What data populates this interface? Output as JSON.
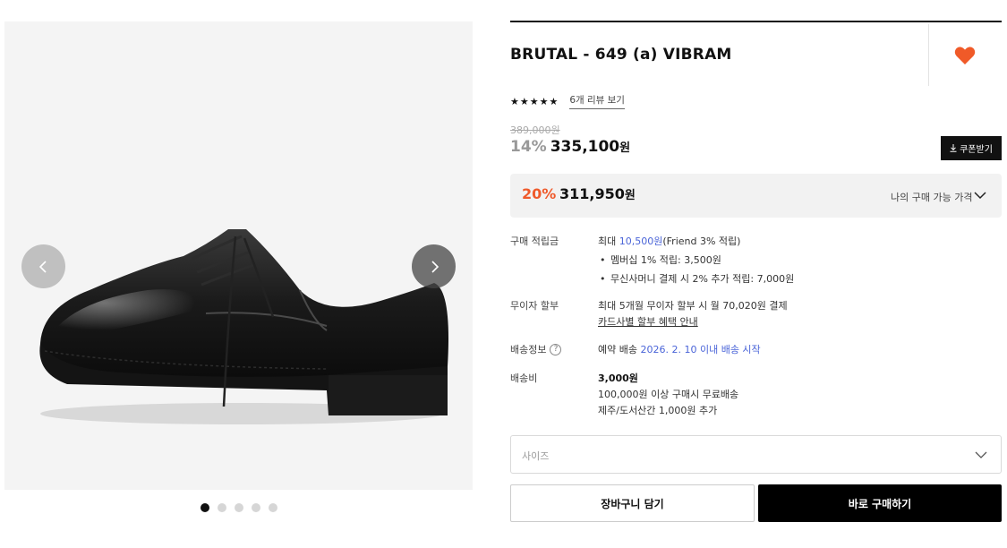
{
  "product": {
    "title": "BRUTAL - 649 (a) VIBRAM",
    "image_alt": "black leather derby shoe"
  },
  "gallery": {
    "prev_icon": "chevron-left-icon",
    "next_icon": "chevron-right-icon",
    "dot_count": 5,
    "active_dot": 1
  },
  "rating": {
    "stars": "★★★★★",
    "review_link": "6개 리뷰 보기"
  },
  "pricing": {
    "original": "389,000원",
    "sale_rate": "14%",
    "sale_price": "335,100",
    "sale_unit": "원",
    "coupon_label": "쿠폰받기",
    "my_rate": "20%",
    "my_price": "311,950",
    "my_unit": "원",
    "my_price_label": "나의 구매 가능 가격"
  },
  "points": {
    "label": "구매 적립금",
    "prefix": "최대",
    "amount": "10,500원",
    "suffix": "(Friend 3% 적립)",
    "bullet1": "멤버십 1% 적립: 3,500원",
    "bullet2": "무신사머니 결제 시 2% 추가 적립: 7,000원"
  },
  "installment": {
    "label": "무이자 할부",
    "text": "최대 5개월 무이자 할부 시 월 70,020원 결제",
    "link": "카드사별 할부 혜택 안내"
  },
  "delivery": {
    "label": "배송정보",
    "prefix": "예약 배송",
    "date_text": "2026. 2. 10 이내 배송 시작"
  },
  "shipping_fee": {
    "label": "배송비",
    "amount": "3,000원",
    "line1": "100,000원 이상 구매시 무료배송",
    "line2": "제주/도서산간 1,000원 추가"
  },
  "size_select": {
    "placeholder": "사이즈"
  },
  "actions": {
    "cart": "장바구니 담기",
    "buy": "바로 구매하기"
  },
  "colors": {
    "heart": "#f05a28",
    "discount": "#ef5a2b",
    "link_blue": "#4a64d8"
  }
}
